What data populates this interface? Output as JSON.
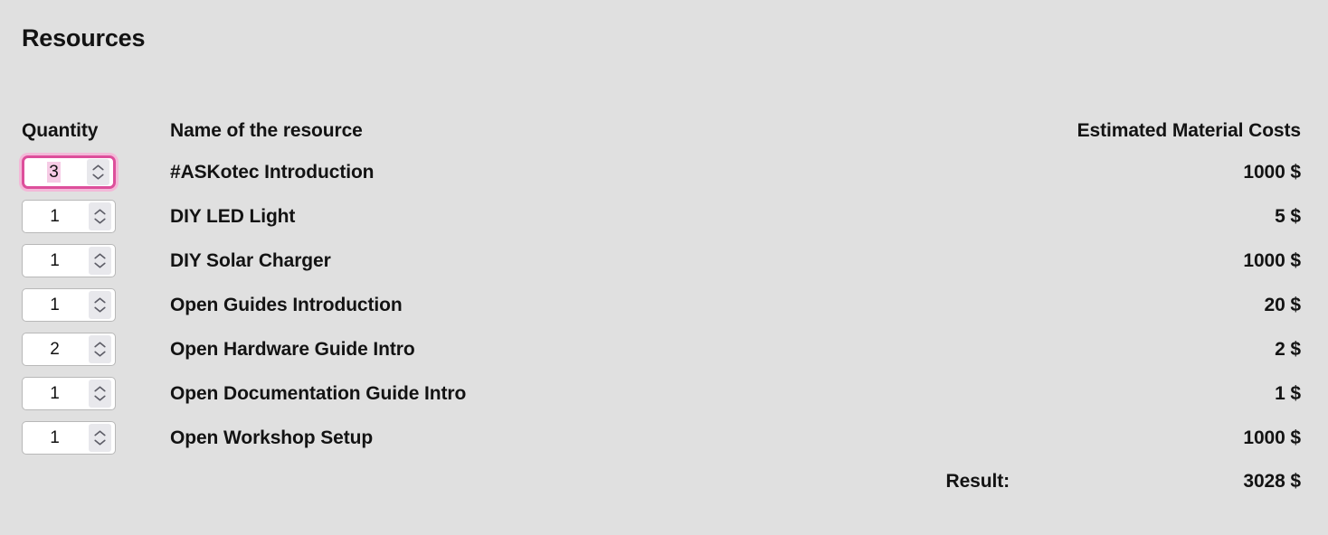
{
  "page": {
    "title": "Resources",
    "background_color": "#e0e0e0",
    "text_color": "#131313",
    "accent_focus_color": "#dd4f9b",
    "selection_highlight_color": "#f6cbe5"
  },
  "table": {
    "headers": {
      "quantity": "Quantity",
      "name": "Name of the resource",
      "cost": "Estimated Material Costs"
    },
    "rows": [
      {
        "quantity": "3",
        "name": "#ASKotec Introduction",
        "cost": "1000 $",
        "focused": true
      },
      {
        "quantity": "1",
        "name": "DIY LED Light",
        "cost": "5 $",
        "focused": false
      },
      {
        "quantity": "1",
        "name": "DIY Solar Charger",
        "cost": "1000 $",
        "focused": false
      },
      {
        "quantity": "1",
        "name": "Open Guides Introduction",
        "cost": "20 $",
        "focused": false
      },
      {
        "quantity": "2",
        "name": "Open Hardware Guide Intro",
        "cost": "2 $",
        "focused": false
      },
      {
        "quantity": "1",
        "name": "Open Documentation Guide Intro",
        "cost": "1 $",
        "focused": false
      },
      {
        "quantity": "1",
        "name": "Open Workshop Setup",
        "cost": "1000 $",
        "focused": false
      }
    ],
    "result": {
      "label": "Result:",
      "value": "3028 $"
    }
  }
}
